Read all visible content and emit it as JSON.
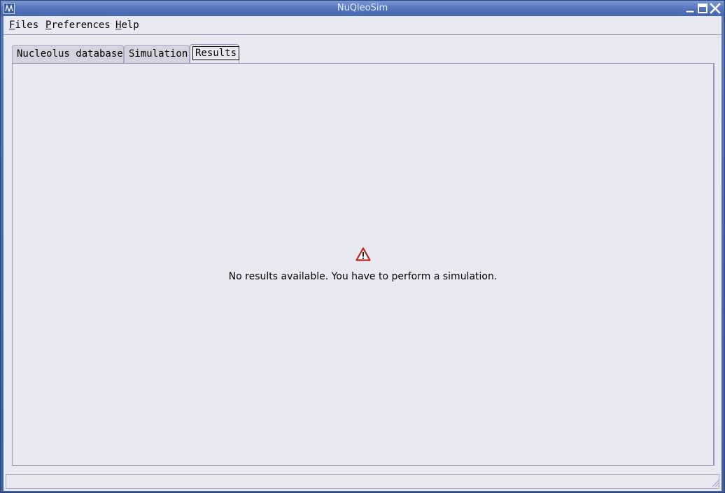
{
  "window": {
    "title": "NuQleoSim"
  },
  "menubar": {
    "items": [
      {
        "mnemonic": "F",
        "rest": "iles"
      },
      {
        "mnemonic": "P",
        "rest": "references"
      },
      {
        "mnemonic": "H",
        "rest": "elp"
      }
    ]
  },
  "tabs": [
    {
      "label": "Nucleolus database"
    },
    {
      "label": "Simulation"
    },
    {
      "label": "Results",
      "active": true
    }
  ],
  "results": {
    "icon": "warning-icon",
    "message": "No results available. You have to perform a simulation."
  },
  "colors": {
    "titlebar": "#5575bd",
    "background": "#e9e9f2",
    "warning": "#c81e1e"
  }
}
